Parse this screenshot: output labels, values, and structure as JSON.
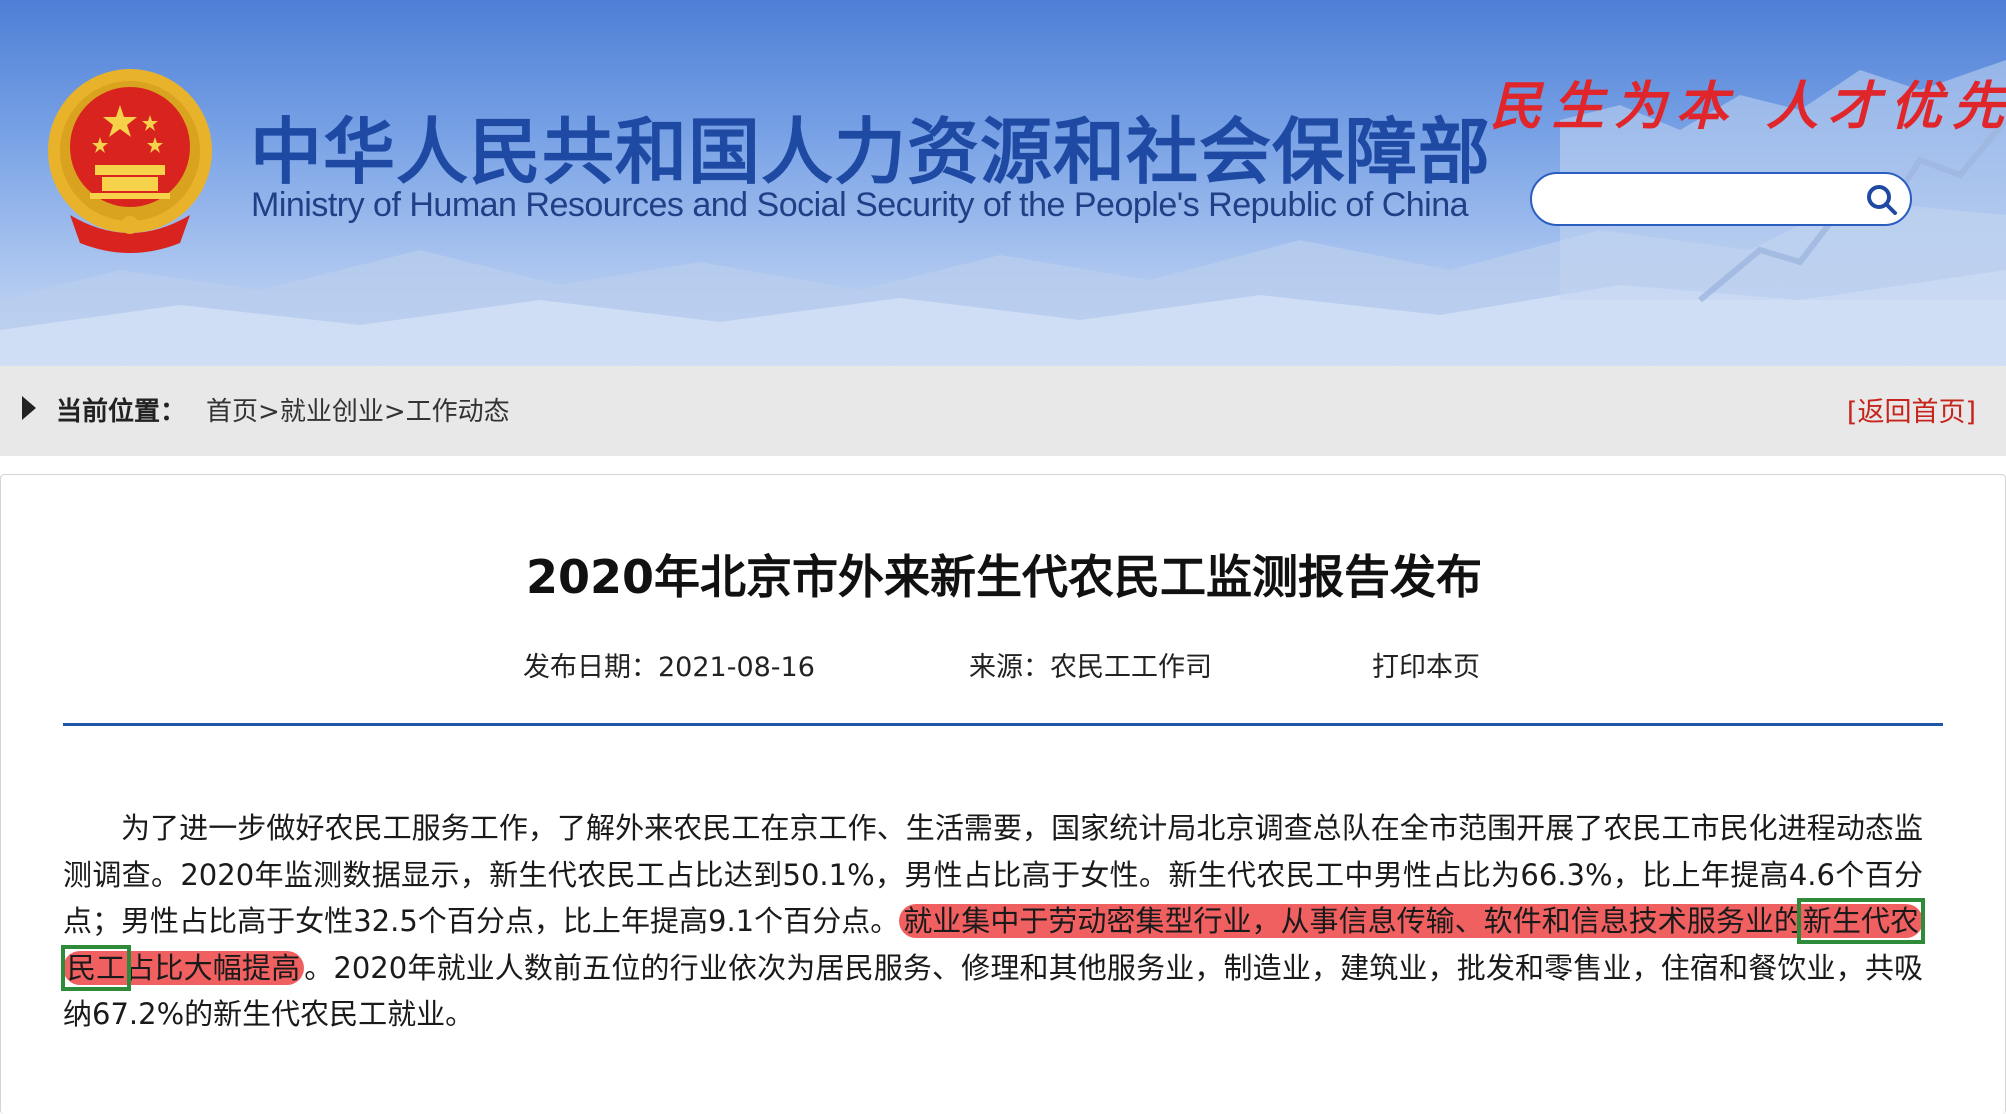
{
  "header": {
    "site_title": "中华人民共和国人力资源和社会保障部",
    "site_subtitle": "Ministry of Human Resources and Social Security of the People's Republic of China",
    "slogan": "民生为本 人才优先",
    "search": {
      "value": "",
      "placeholder": "",
      "icon": "search-icon"
    },
    "emblem_icon": "national-emblem"
  },
  "breadcrumb": {
    "label": "当前位置：",
    "path": [
      {
        "label": "首页",
        "sep": ">"
      },
      {
        "label": "就业创业",
        "sep": ">"
      },
      {
        "label": "工作动态",
        "sep": ""
      }
    ],
    "back_home": "[返回首页]",
    "arrow_icon": "play-arrow-icon"
  },
  "article": {
    "title": "2020年北京市外来新生代农民工监测报告发布",
    "publish_date": "发布日期：2021-08-16",
    "source": "来源：农民工工作司",
    "print": "打印本页",
    "body": {
      "part1": "为了进一步做好农民工服务工作，了解外来农民工在京工作、生活需要，国家统计局北京调查总队在全市范围开展了农民工市民化进程动态监测调查。2020年监测数据显示，新生代农民工占比达到50.1%，男性占比高于女性。新生代农民工中男性占比为66.3%，比上年提高4.6个百分点；男性占比高于女性32.5个百分点，比上年提高9.1个百分点。",
      "highlight_a": "就业集中于劳动密集型行业，从事信息传输、软件和信息技术服务业的",
      "highlight_boxed": "新生代农民工",
      "highlight_b": "占比大幅提高",
      "part2": "。2020年就业人数前五位的行业依次为居民服务、修理和其他服务业，制造业，建筑业，批发和零售业，住宿和餐饮业，共吸纳67.2%的新生代农民工就业。"
    }
  },
  "colors": {
    "title_blue": "#1f4aa3",
    "slogan_red": "#e0262a",
    "divider_blue": "#1e56a8",
    "highlight_red": "#ee4a4a",
    "box_green": "#2e8b3a",
    "back_home_red": "#c6241d"
  }
}
